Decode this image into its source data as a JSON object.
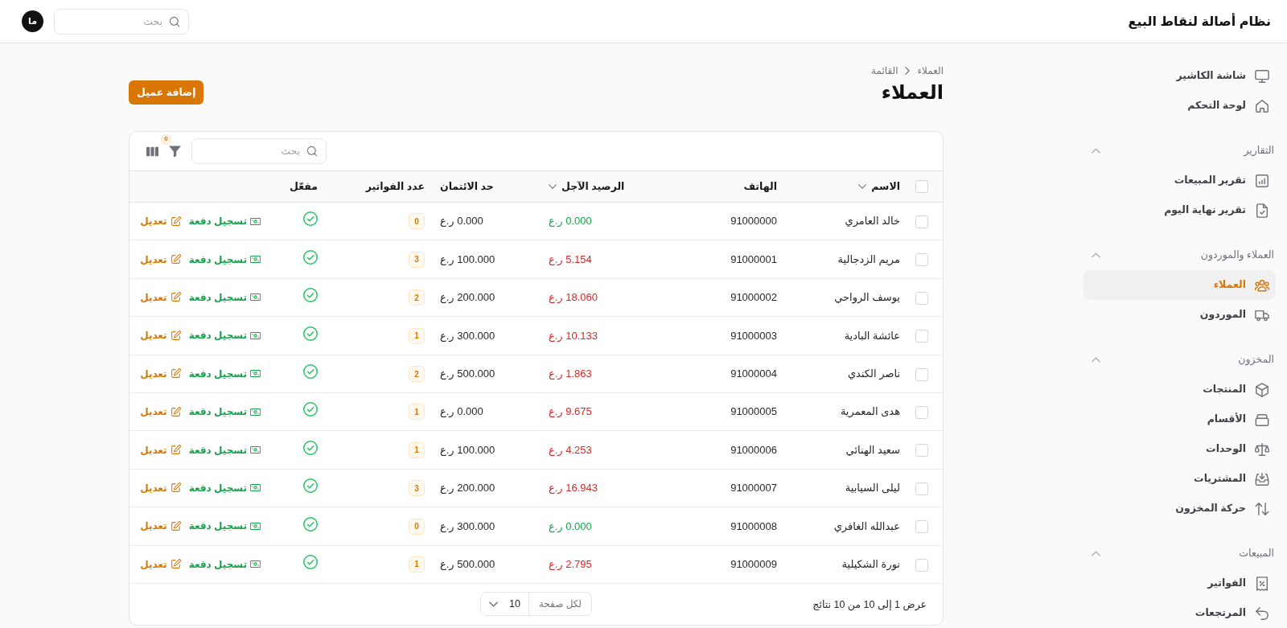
{
  "app": {
    "title": "نظام أصالة لنقاط البيع",
    "search": {
      "placeholder": "بحث"
    },
    "avatar": "ما"
  },
  "sidebar": {
    "sections": [
      {
        "items": [
          {
            "label": "شاشة الكاشير",
            "selected": false
          },
          {
            "label": "لوحة التحكم",
            "selected": false
          }
        ]
      },
      {
        "title": "التقارير",
        "expanded": true,
        "items": [
          {
            "label": "تقرير المبيعات",
            "selected": false
          },
          {
            "label": "تقرير نهاية اليوم",
            "selected": false
          }
        ]
      },
      {
        "title": "العملاء والموردون",
        "expanded": true,
        "items": [
          {
            "label": "العملاء",
            "selected": true
          },
          {
            "label": "الموردون",
            "selected": false
          }
        ]
      },
      {
        "title": "المخزون",
        "expanded": true,
        "items": [
          {
            "label": "المنتجات",
            "selected": false
          },
          {
            "label": "الأقسام",
            "selected": false
          },
          {
            "label": "الوحدات",
            "selected": false
          },
          {
            "label": "المشتريات",
            "selected": false
          },
          {
            "label": "حركة المخزون",
            "selected": false
          }
        ]
      },
      {
        "title": "المبيعات",
        "expanded": true,
        "items": [
          {
            "label": "الفواتير",
            "selected": false
          },
          {
            "label": "المرتجعات",
            "selected": false
          }
        ]
      }
    ]
  },
  "breadcrumb": [
    "العملاء",
    "القائمة"
  ],
  "page": {
    "title": "العملاء",
    "add_button": "إضافة عميل"
  },
  "table": {
    "search": {
      "placeholder": "بحث"
    },
    "filter_count": "0",
    "select_all_checked": false,
    "columns": [
      {
        "label": "الاسم",
        "sortable": true
      },
      {
        "label": "الهاتف",
        "sortable": false
      },
      {
        "label": "الرصيد الآجل",
        "sortable": true
      },
      {
        "label": "حد الائتمان",
        "sortable": false
      },
      {
        "label": "عدد الفواتير",
        "sortable": false
      },
      {
        "label": "مفعّل",
        "sortable": false
      }
    ],
    "rows": [
      {
        "selected": false,
        "name": "خالد العامري",
        "phone": "91000000",
        "balance": "0.000 ر.ع",
        "balance_due": false,
        "credit_limit": "0.000 ر.ع",
        "invoices": "0",
        "enabled": true,
        "actions": [
          {
            "kind": "payment",
            "label": "تسجيل دفعة"
          },
          {
            "kind": "edit",
            "label": "تعديل"
          }
        ]
      },
      {
        "selected": false,
        "name": "مريم الزدجالية",
        "phone": "91000001",
        "balance": "5.154 ر.ع",
        "balance_due": true,
        "credit_limit": "100.000 ر.ع",
        "invoices": "3",
        "enabled": true,
        "actions": [
          {
            "kind": "payment",
            "label": "تسجيل دفعة"
          },
          {
            "kind": "edit",
            "label": "تعديل"
          }
        ]
      },
      {
        "selected": false,
        "name": "يوسف الرواحي",
        "phone": "91000002",
        "balance": "18.060 ر.ع",
        "balance_due": true,
        "credit_limit": "200.000 ر.ع",
        "invoices": "2",
        "enabled": true,
        "actions": [
          {
            "kind": "payment",
            "label": "تسجيل دفعة"
          },
          {
            "kind": "edit",
            "label": "تعديل"
          }
        ]
      },
      {
        "selected": false,
        "name": "عائشة البادية",
        "phone": "91000003",
        "balance": "10.133 ر.ع",
        "balance_due": true,
        "credit_limit": "300.000 ر.ع",
        "invoices": "1",
        "enabled": true,
        "actions": [
          {
            "kind": "payment",
            "label": "تسجيل دفعة"
          },
          {
            "kind": "edit",
            "label": "تعديل"
          }
        ]
      },
      {
        "selected": false,
        "name": "ناصر الكندي",
        "phone": "91000004",
        "balance": "1.863 ر.ع",
        "balance_due": true,
        "credit_limit": "500.000 ر.ع",
        "invoices": "2",
        "enabled": true,
        "actions": [
          {
            "kind": "payment",
            "label": "تسجيل دفعة"
          },
          {
            "kind": "edit",
            "label": "تعديل"
          }
        ]
      },
      {
        "selected": false,
        "name": "هدى المعمرية",
        "phone": "91000005",
        "balance": "9.675 ر.ع",
        "balance_due": true,
        "credit_limit": "0.000 ر.ع",
        "invoices": "1",
        "enabled": true,
        "actions": [
          {
            "kind": "payment",
            "label": "تسجيل دفعة"
          },
          {
            "kind": "edit",
            "label": "تعديل"
          }
        ]
      },
      {
        "selected": false,
        "name": "سعيد الهنائي",
        "phone": "91000006",
        "balance": "4.253 ر.ع",
        "balance_due": true,
        "credit_limit": "100.000 ر.ع",
        "invoices": "1",
        "enabled": true,
        "actions": [
          {
            "kind": "payment",
            "label": "تسجيل دفعة"
          },
          {
            "kind": "edit",
            "label": "تعديل"
          }
        ]
      },
      {
        "selected": false,
        "name": "ليلى السيابية",
        "phone": "91000007",
        "balance": "16.943 ر.ع",
        "balance_due": true,
        "credit_limit": "200.000 ر.ع",
        "invoices": "3",
        "enabled": true,
        "actions": [
          {
            "kind": "payment",
            "label": "تسجيل دفعة"
          },
          {
            "kind": "edit",
            "label": "تعديل"
          }
        ]
      },
      {
        "selected": false,
        "name": "عبدالله الغافري",
        "phone": "91000008",
        "balance": "0.000 ر.ع",
        "balance_due": false,
        "credit_limit": "300.000 ر.ع",
        "invoices": "0",
        "enabled": true,
        "actions": [
          {
            "kind": "payment",
            "label": "تسجيل دفعة"
          },
          {
            "kind": "edit",
            "label": "تعديل"
          }
        ]
      },
      {
        "selected": false,
        "name": "نورة الشكيلية",
        "phone": "91000009",
        "balance": "2.795 ر.ع",
        "balance_due": true,
        "credit_limit": "500.000 ر.ع",
        "invoices": "1",
        "enabled": true,
        "actions": [
          {
            "kind": "payment",
            "label": "تسجيل دفعة"
          },
          {
            "kind": "edit",
            "label": "تعديل"
          }
        ]
      }
    ],
    "pagination": {
      "summary": "عرض 1 إلى 10 من 10 نتائج",
      "per_page_label": "لكل صفحة",
      "per_page": "10"
    }
  }
}
